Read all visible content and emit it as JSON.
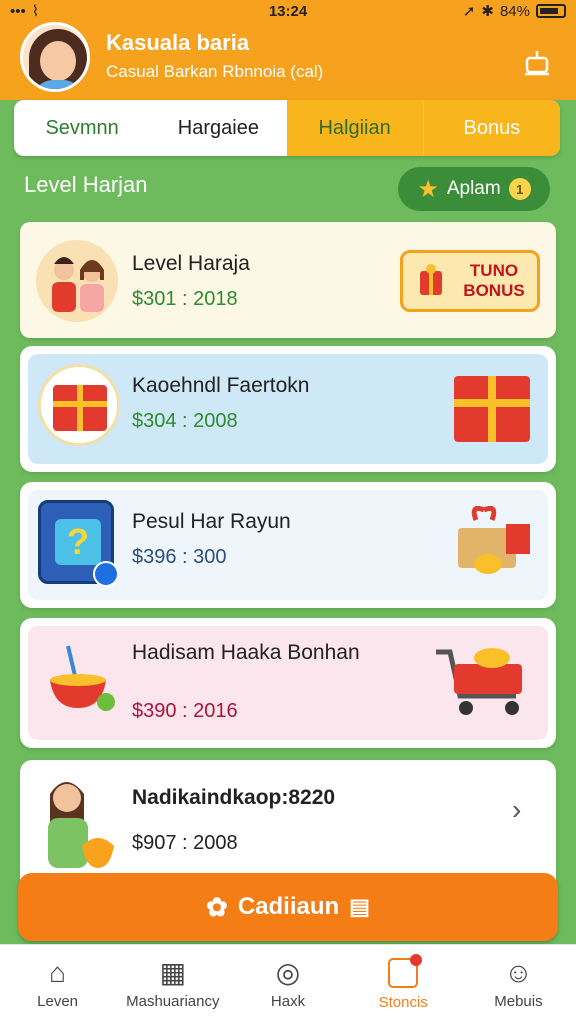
{
  "status": {
    "time": "13:24",
    "battery": "84%"
  },
  "header": {
    "title": "Kasuala baria",
    "subtitle": "Casual Barkan Rbnnoia (cal)"
  },
  "tabs": [
    "Sevmnn",
    "Hargaiee",
    "Halgiian",
    "Bonus"
  ],
  "section": {
    "title": "Level Harjan",
    "apply_label": "Aplam"
  },
  "cards": [
    {
      "title": "Level Haraja",
      "amount": "$301 : 2018",
      "tag": "TUNO BONUS"
    },
    {
      "title": "Kaoehndl Faertokn",
      "amount": "$304 : 2008"
    },
    {
      "title": "Pesul Har Rayun",
      "amount": "$396 : 300"
    },
    {
      "title": "Hadisam Haaka Bonhan",
      "amount": "$390 : 2016"
    },
    {
      "title": "Nadikaindkaop:8220",
      "amount": "$907 : 2008"
    }
  ],
  "cta": {
    "label": "Cadiiaun"
  },
  "nav": [
    {
      "label": "Leven",
      "icon": "home-icon"
    },
    {
      "label": "Mashuariancy",
      "icon": "store-icon"
    },
    {
      "label": "Haxk",
      "icon": "compass-icon"
    },
    {
      "label": "Stoncis",
      "icon": "bookmark-icon",
      "active": true
    },
    {
      "label": "Mebuis",
      "icon": "user-icon"
    }
  ],
  "colors": {
    "header": "#f7a21f",
    "bg": "#6dbb5c",
    "cta": "#f47d16",
    "accent": "#3c8d3a"
  }
}
